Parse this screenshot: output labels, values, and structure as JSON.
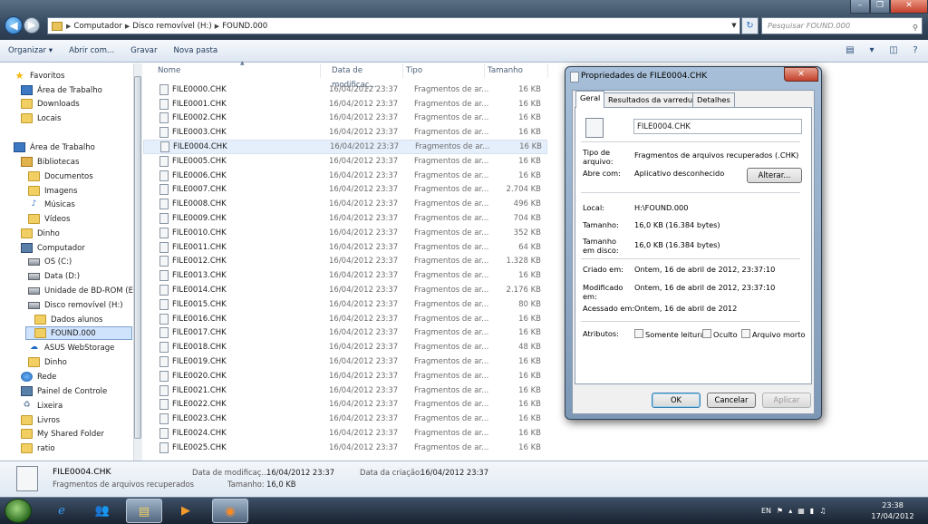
{
  "address": {
    "crumbs": [
      "Computador",
      "Disco removível (H:)",
      "FOUND.000"
    ],
    "search_placeholder": "Pesquisar FOUND.000"
  },
  "toolbar": {
    "organize": "Organizar ▾",
    "open_with": "Abrir com...",
    "burn": "Gravar",
    "new_folder": "Nova pasta"
  },
  "nav": {
    "favorites": "Favoritos",
    "fav_desktop": "Área de Trabalho",
    "downloads": "Downloads",
    "locais": "Locais",
    "desktop": "Área de Trabalho",
    "libraries": "Bibliotecas",
    "documents": "Documentos",
    "images": "Imagens",
    "music": "Músicas",
    "videos": "Vídeos",
    "dinho": "Dinho",
    "computer": "Computador",
    "os_c": "OS (C:)",
    "data_d": "Data (D:)",
    "bdrom": "Unidade de BD-ROM (E:)",
    "removable": "Disco removível (H:)",
    "dados": "Dados alunos",
    "found": "FOUND.000",
    "asus": "ASUS WebStorage",
    "dinho2": "Dinho",
    "network": "Rede",
    "control": "Painel de Controle",
    "trash": "Lixeira",
    "books": "Livros",
    "shared": "My Shared Folder",
    "ratio": "ratio"
  },
  "columns": {
    "name": "Nome",
    "date": "Data de modificaç...",
    "type": "Tipo",
    "size": "Tamanho"
  },
  "files": [
    {
      "name": "FILE0000.CHK",
      "date": "16/04/2012 23:37",
      "type": "Fragmentos de ar...",
      "size": "16 KB"
    },
    {
      "name": "FILE0001.CHK",
      "date": "16/04/2012 23:37",
      "type": "Fragmentos de ar...",
      "size": "16 KB"
    },
    {
      "name": "FILE0002.CHK",
      "date": "16/04/2012 23:37",
      "type": "Fragmentos de ar...",
      "size": "16 KB"
    },
    {
      "name": "FILE0003.CHK",
      "date": "16/04/2012 23:37",
      "type": "Fragmentos de ar...",
      "size": "16 KB"
    },
    {
      "name": "FILE0004.CHK",
      "date": "16/04/2012 23:37",
      "type": "Fragmentos de ar...",
      "size": "16 KB"
    },
    {
      "name": "FILE0005.CHK",
      "date": "16/04/2012 23:37",
      "type": "Fragmentos de ar...",
      "size": "16 KB"
    },
    {
      "name": "FILE0006.CHK",
      "date": "16/04/2012 23:37",
      "type": "Fragmentos de ar...",
      "size": "16 KB"
    },
    {
      "name": "FILE0007.CHK",
      "date": "16/04/2012 23:37",
      "type": "Fragmentos de ar...",
      "size": "2.704 KB"
    },
    {
      "name": "FILE0008.CHK",
      "date": "16/04/2012 23:37",
      "type": "Fragmentos de ar...",
      "size": "496 KB"
    },
    {
      "name": "FILE0009.CHK",
      "date": "16/04/2012 23:37",
      "type": "Fragmentos de ar...",
      "size": "704 KB"
    },
    {
      "name": "FILE0010.CHK",
      "date": "16/04/2012 23:37",
      "type": "Fragmentos de ar...",
      "size": "352 KB"
    },
    {
      "name": "FILE0011.CHK",
      "date": "16/04/2012 23:37",
      "type": "Fragmentos de ar...",
      "size": "64 KB"
    },
    {
      "name": "FILE0012.CHK",
      "date": "16/04/2012 23:37",
      "type": "Fragmentos de ar...",
      "size": "1.328 KB"
    },
    {
      "name": "FILE0013.CHK",
      "date": "16/04/2012 23:37",
      "type": "Fragmentos de ar...",
      "size": "16 KB"
    },
    {
      "name": "FILE0014.CHK",
      "date": "16/04/2012 23:37",
      "type": "Fragmentos de ar...",
      "size": "2.176 KB"
    },
    {
      "name": "FILE0015.CHK",
      "date": "16/04/2012 23:37",
      "type": "Fragmentos de ar...",
      "size": "80 KB"
    },
    {
      "name": "FILE0016.CHK",
      "date": "16/04/2012 23:37",
      "type": "Fragmentos de ar...",
      "size": "16 KB"
    },
    {
      "name": "FILE0017.CHK",
      "date": "16/04/2012 23:37",
      "type": "Fragmentos de ar...",
      "size": "16 KB"
    },
    {
      "name": "FILE0018.CHK",
      "date": "16/04/2012 23:37",
      "type": "Fragmentos de ar...",
      "size": "48 KB"
    },
    {
      "name": "FILE0019.CHK",
      "date": "16/04/2012 23:37",
      "type": "Fragmentos de ar...",
      "size": "16 KB"
    },
    {
      "name": "FILE0020.CHK",
      "date": "16/04/2012 23:37",
      "type": "Fragmentos de ar...",
      "size": "16 KB"
    },
    {
      "name": "FILE0021.CHK",
      "date": "16/04/2012 23:37",
      "type": "Fragmentos de ar...",
      "size": "16 KB"
    },
    {
      "name": "FILE0022.CHK",
      "date": "16/04/2012 23:37",
      "type": "Fragmentos de ar...",
      "size": "16 KB"
    },
    {
      "name": "FILE0023.CHK",
      "date": "16/04/2012 23:37",
      "type": "Fragmentos de ar...",
      "size": "16 KB"
    },
    {
      "name": "FILE0024.CHK",
      "date": "16/04/2012 23:37",
      "type": "Fragmentos de ar...",
      "size": "16 KB"
    },
    {
      "name": "FILE0025.CHK",
      "date": "16/04/2012 23:37",
      "type": "Fragmentos de ar...",
      "size": "16 KB"
    }
  ],
  "details": {
    "name": "FILE0004.CHK",
    "type": "Fragmentos de arquivos recuperados",
    "modified_label": "Data de modificaç...",
    "modified_value": "16/04/2012 23:37",
    "size_label": "Tamanho:",
    "size_value": "16,0 KB",
    "created_label": "Data da criação:",
    "created_value": "16/04/2012 23:37"
  },
  "dialog": {
    "title": "Propriedades de FILE0004.CHK",
    "tabs": [
      "Geral",
      "Resultados da varredura",
      "Detalhes"
    ],
    "filename": "FILE0004.CHK",
    "type_label": "Tipo de arquivo:",
    "type_value": "Fragmentos de arquivos recuperados (.CHK)",
    "opens_label": "Abre com:",
    "opens_value": "Aplicativo desconhecido",
    "change_button": "Alterar...",
    "location_label": "Local:",
    "location_value": "H:\\FOUND.000",
    "size_label": "Tamanho:",
    "size_value": "16,0 KB (16.384 bytes)",
    "disk_size_label": "Tamanho em disco:",
    "disk_size_value": "16,0 KB (16.384 bytes)",
    "created_label": "Criado em:",
    "created_value": "Ontem, 16 de abril de 2012, 23:37:10",
    "modified_label": "Modificado em:",
    "modified_value": "Ontem, 16 de abril de 2012, 23:37:10",
    "accessed_label": "Acessado em:",
    "accessed_value": "Ontem, 16 de abril de 2012",
    "attributes_label": "Atributos:",
    "attr_readonly": "Somente leitura",
    "attr_hidden": "Oculto",
    "attr_archive": "Arquivo morto",
    "ok": "OK",
    "cancel": "Cancelar",
    "apply": "Aplicar"
  },
  "tray": {
    "lang": "EN",
    "time": "23:38",
    "date": "17/04/2012"
  }
}
